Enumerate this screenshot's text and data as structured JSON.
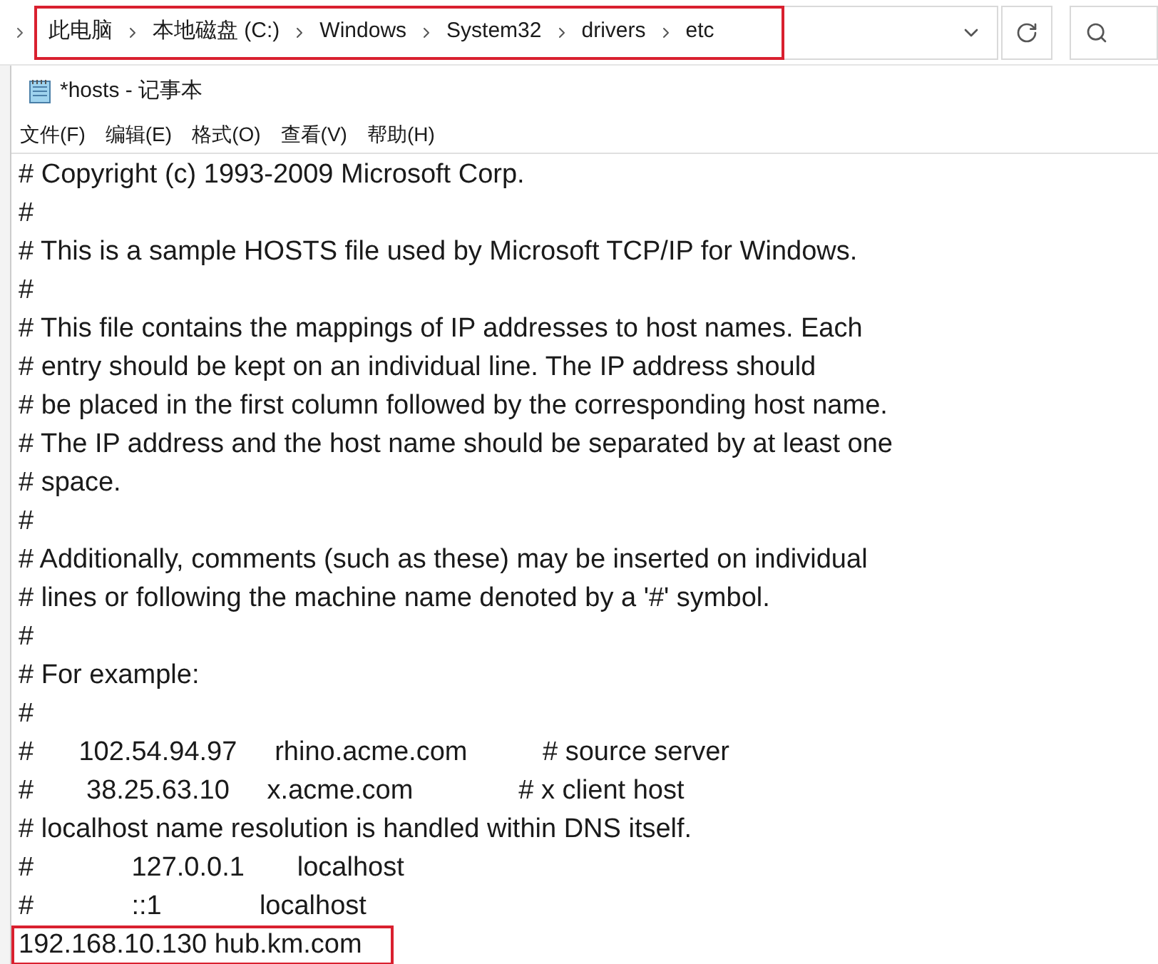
{
  "explorer": {
    "breadcrumb": [
      {
        "label": "此电脑"
      },
      {
        "label": "本地磁盘 (C:)"
      },
      {
        "label": "Windows"
      },
      {
        "label": "System32"
      },
      {
        "label": "drivers"
      },
      {
        "label": "etc"
      }
    ],
    "breadcrumb_highlighted": true
  },
  "notepad": {
    "title": "*hosts - 记事本",
    "menu": [
      "文件(F)",
      "编辑(E)",
      "格式(O)",
      "查看(V)",
      "帮助(H)"
    ],
    "lines": [
      {
        "text": "# Copyright (c) 1993-2009 Microsoft Corp.",
        "highlighted": false
      },
      {
        "text": "#",
        "highlighted": false
      },
      {
        "text": "# This is a sample HOSTS file used by Microsoft TCP/IP for Windows.",
        "highlighted": false
      },
      {
        "text": "#",
        "highlighted": false
      },
      {
        "text": "# This file contains the mappings of IP addresses to host names. Each",
        "highlighted": false
      },
      {
        "text": "# entry should be kept on an individual line. The IP address should",
        "highlighted": false
      },
      {
        "text": "# be placed in the first column followed by the corresponding host name.",
        "highlighted": false
      },
      {
        "text": "# The IP address and the host name should be separated by at least one",
        "highlighted": false
      },
      {
        "text": "# space.",
        "highlighted": false
      },
      {
        "text": "#",
        "highlighted": false
      },
      {
        "text": "# Additionally, comments (such as these) may be inserted on individual",
        "highlighted": false
      },
      {
        "text": "# lines or following the machine name denoted by a '#' symbol.",
        "highlighted": false
      },
      {
        "text": "#",
        "highlighted": false
      },
      {
        "text": "# For example:",
        "highlighted": false
      },
      {
        "text": "#",
        "highlighted": false
      },
      {
        "text": "#      102.54.94.97     rhino.acme.com          # source server",
        "highlighted": false
      },
      {
        "text": "#       38.25.63.10     x.acme.com              # x client host",
        "highlighted": false
      },
      {
        "text": "# localhost name resolution is handled within DNS itself.",
        "highlighted": false
      },
      {
        "text": "#             127.0.0.1       localhost",
        "highlighted": false
      },
      {
        "text": "#             ::1             localhost",
        "highlighted": false
      },
      {
        "text": "192.168.10.130 hub.km.com",
        "highlighted": true
      }
    ]
  }
}
